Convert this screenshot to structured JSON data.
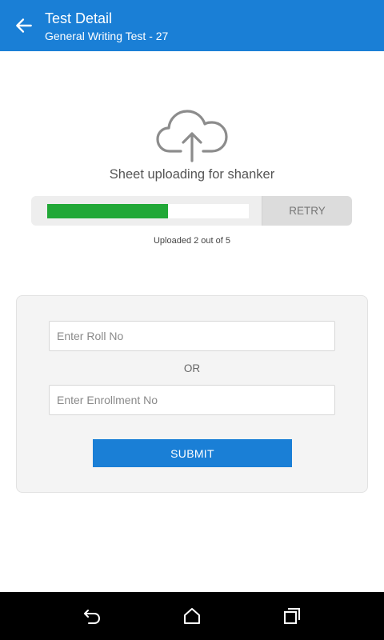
{
  "header": {
    "title": "Test Detail",
    "subtitle": "General Writing Test - 27",
    "back_icon": "arrow-left-icon",
    "background": "#1a7fd6"
  },
  "upload": {
    "icon": "cloud-upload-icon",
    "title": "Sheet uploading for shanker",
    "progress_fraction": 0.6,
    "progress_color": "#21a837",
    "retry_label": "RETRY",
    "status": "Uploaded 2 out of 5"
  },
  "form": {
    "roll_no_placeholder": "Enter Roll No",
    "roll_no_value": "",
    "or_label": "OR",
    "enrollment_placeholder": "Enter Enrollment No",
    "enrollment_value": "",
    "submit_label": "SUBMIT",
    "accent": "#1a7fd6"
  },
  "navbar": {
    "back_icon": "nav-back-icon",
    "home_icon": "home-icon",
    "recents_icon": "recent-apps-icon"
  }
}
